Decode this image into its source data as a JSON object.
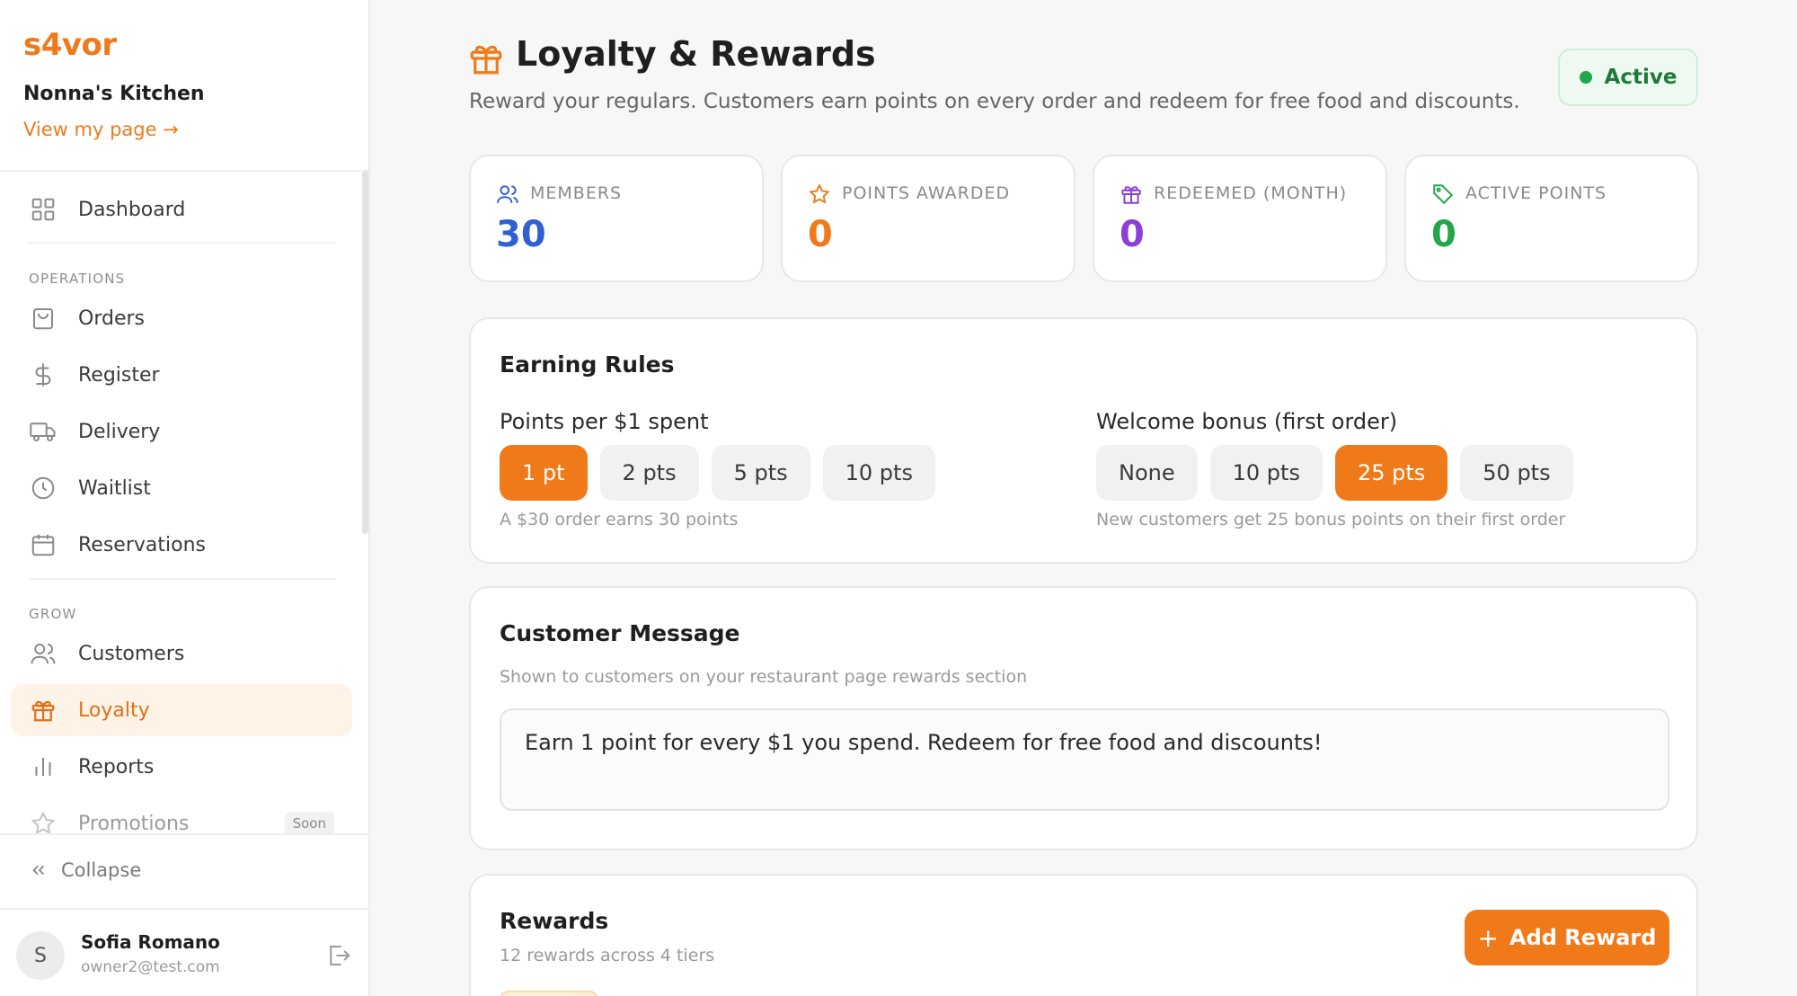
{
  "sidebar": {
    "brand": "s4vor",
    "restaurant_name": "Nonna's Kitchen",
    "view_page_link": "View my page →",
    "items": {
      "dashboard": "Dashboard",
      "orders": "Orders",
      "register": "Register",
      "delivery": "Delivery",
      "waitlist": "Waitlist",
      "reservations": "Reservations",
      "customers": "Customers",
      "loyalty": "Loyalty",
      "reports": "Reports",
      "promotions": "Promotions"
    },
    "sections": {
      "operations": "OPERATIONS",
      "grow": "GROW"
    },
    "promotions_badge": "Soon",
    "collapse_label": "Collapse",
    "user": {
      "initial": "S",
      "name": "Sofia Romano",
      "email": "owner2@test.com"
    }
  },
  "header": {
    "title": "Loyalty & Rewards",
    "subtitle": "Reward your regulars. Customers earn points on every order and redeem for free food and discounts.",
    "status": "Active"
  },
  "stats": [
    {
      "label": "MEMBERS",
      "value": "30",
      "icon": "users-icon",
      "color": "#2f5fd0"
    },
    {
      "label": "POINTS AWARDED",
      "value": "0",
      "icon": "star-icon",
      "color": "#f07a1a"
    },
    {
      "label": "REDEEMED (MONTH)",
      "value": "0",
      "icon": "gift-icon",
      "color": "#8a3fd6"
    },
    {
      "label": "ACTIVE POINTS",
      "value": "0",
      "icon": "tag-icon",
      "color": "#22a64a"
    }
  ],
  "earning_rules": {
    "title": "Earning Rules",
    "points_label": "Points per $1 spent",
    "points_options": [
      "1 pt",
      "2 pts",
      "5 pts",
      "10 pts"
    ],
    "points_selected": "1 pt",
    "points_hint": "A $30 order earns 30 points",
    "bonus_label": "Welcome bonus (first order)",
    "bonus_options": [
      "None",
      "10 pts",
      "25 pts",
      "50 pts"
    ],
    "bonus_selected": "25 pts",
    "bonus_hint": "New customers get 25 bonus points on their first order"
  },
  "customer_message": {
    "title": "Customer Message",
    "description": "Shown to customers on your restaurant page rewards section",
    "value": "Earn 1 point for every $1 you spend. Redeem for free food and discounts!"
  },
  "rewards": {
    "title": "Rewards",
    "summary": "12 rewards across 4 tiers",
    "add_button": "Add Reward"
  },
  "colors": {
    "accent": "#f07a1a",
    "active_green": "#22a64a"
  }
}
